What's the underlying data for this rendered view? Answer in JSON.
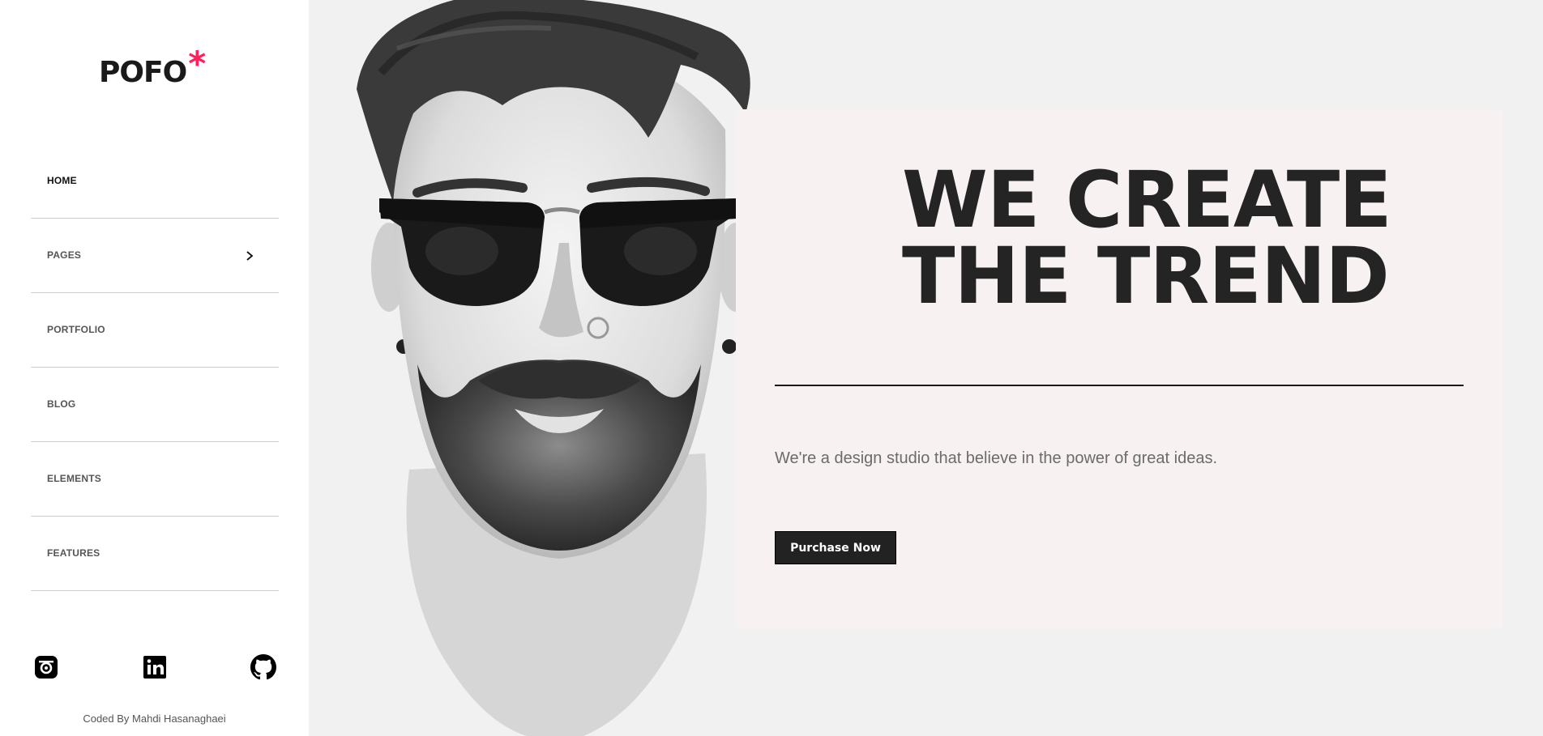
{
  "sidebar": {
    "logo_text": "POFO",
    "logo_mark": "*",
    "nav": [
      {
        "label": "HOME",
        "active": true
      },
      {
        "label": "PAGES",
        "has_submenu": true
      },
      {
        "label": "PORTFOLIO"
      },
      {
        "label": "BLOG"
      },
      {
        "label": "ELEMENTS"
      },
      {
        "label": "FEATURES"
      }
    ],
    "socials": [
      "instagram-icon",
      "linkedin-icon",
      "github-icon"
    ],
    "credit": "Coded By Mahdi Hasanaghaei"
  },
  "hero": {
    "headline_line1": "WE CREATE",
    "headline_line2": "THE TREND",
    "tagline": "We're a design studio that believe in the power of great ideas.",
    "cta_label": "Purchase Now"
  },
  "colors": {
    "accent": "#ff1f5a",
    "page_bg": "#f1f1f1",
    "card_bg": "#f8f1f1",
    "dark": "#222222"
  }
}
